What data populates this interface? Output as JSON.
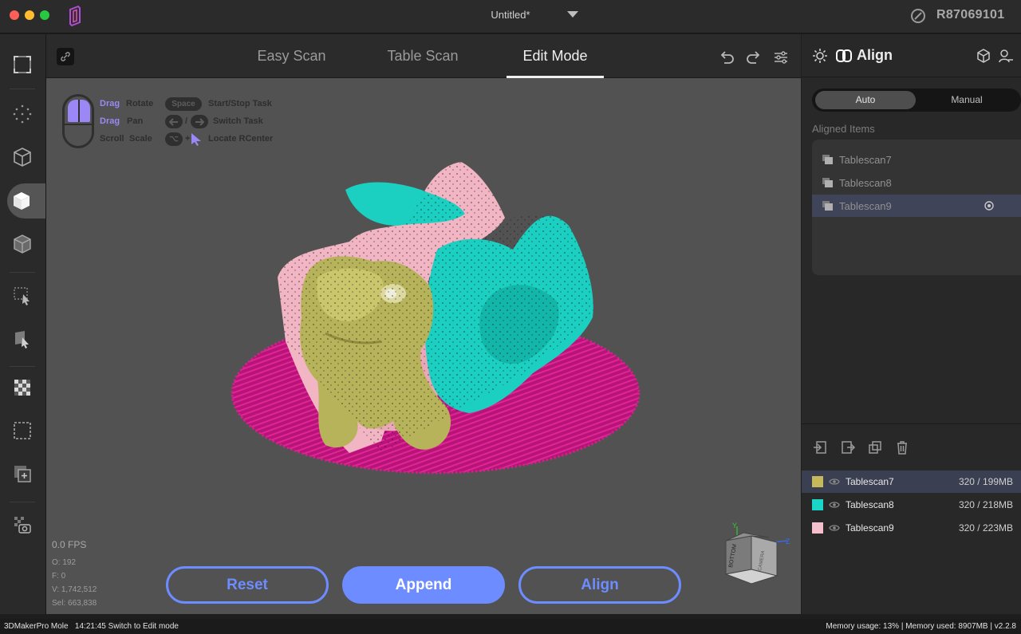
{
  "window": {
    "title": "Untitled*",
    "user_id": "R87069101"
  },
  "tabs": [
    {
      "label": "Easy Scan",
      "active": false
    },
    {
      "label": "Table Scan",
      "active": false
    },
    {
      "label": "Edit Mode",
      "active": true
    }
  ],
  "viewport": {
    "hints": {
      "drag1": "Drag",
      "rotate": "Rotate",
      "drag2": "Drag",
      "pan": "Pan",
      "scroll": "Scroll",
      "scale": "Scale",
      "space_key": "Space",
      "start_stop": "Start/Stop Task",
      "slash": "/",
      "switch_task": "Switch Task",
      "alt_key": "⌥",
      "plus": "+",
      "locate": "Locate RCenter"
    },
    "fps": "0.0 FPS",
    "stats": {
      "o": "O: 192",
      "f": "F: 0",
      "v": "V: 1,742,512",
      "sel": "Sel: 663,838"
    },
    "buttons": {
      "reset": "Reset",
      "append": "Append",
      "align": "Align"
    },
    "navcube": {
      "face1": "BOTTOM",
      "face2": "CAMERA",
      "axis_y": "Y",
      "axis_z": "Z",
      "axis_x": "X"
    }
  },
  "right_panel": {
    "title": "Align",
    "segments": {
      "auto": "Auto",
      "manual": "Manual",
      "selected": "Auto"
    },
    "aligned_label": "Aligned Items",
    "aligned_items": [
      {
        "name": "Tablescan7",
        "selected": false
      },
      {
        "name": "Tablescan8",
        "selected": false
      },
      {
        "name": "Tablescan9",
        "selected": true
      }
    ],
    "scans": [
      {
        "name": "Tablescan7",
        "size": "320 / 199MB",
        "color": "#c6b95c",
        "selected": true
      },
      {
        "name": "Tablescan8",
        "size": "320 / 218MB",
        "color": "#19d6c7",
        "selected": false
      },
      {
        "name": "Tablescan9",
        "size": "320 / 223MB",
        "color": "#f7bfcc",
        "selected": false
      }
    ]
  },
  "statusbar": {
    "left": "3DMakerPro Mole   14:21:45 Switch to Edit mode",
    "right": "Memory usage: 13% | Memory used: 8907MB | v2.2.8"
  },
  "colors": {
    "accent": "#6d8cff",
    "hint_purple": "#9b87f5",
    "scan_magenta": "#c8177e"
  }
}
